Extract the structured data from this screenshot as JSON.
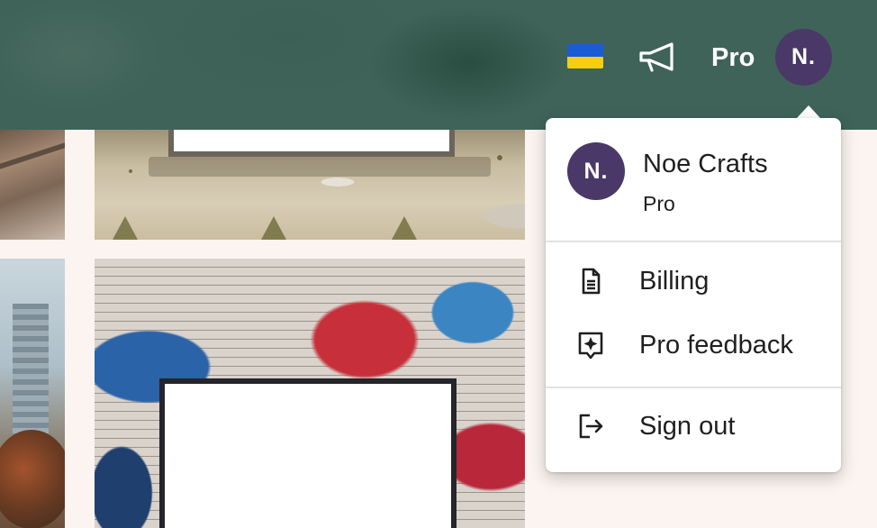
{
  "header": {
    "flag_icon": "ukraine-flag-icon",
    "megaphone_icon": "megaphone-icon",
    "plan_label": "Pro",
    "avatar_initials": "N.",
    "colors": {
      "bar": "#3f6359",
      "avatar": "#4a3868",
      "flag_blue": "#1a5bd6",
      "flag_yellow": "#f5cf0f"
    }
  },
  "profile_menu": {
    "user": {
      "avatar_initials": "N.",
      "name": "Noe Crafts",
      "plan": "Pro"
    },
    "items": [
      {
        "label": "Billing",
        "icon": "document-icon"
      },
      {
        "label": "Pro feedback",
        "icon": "sparkle-message-icon"
      },
      {
        "label": "Sign out",
        "icon": "sign-out-icon"
      }
    ]
  }
}
